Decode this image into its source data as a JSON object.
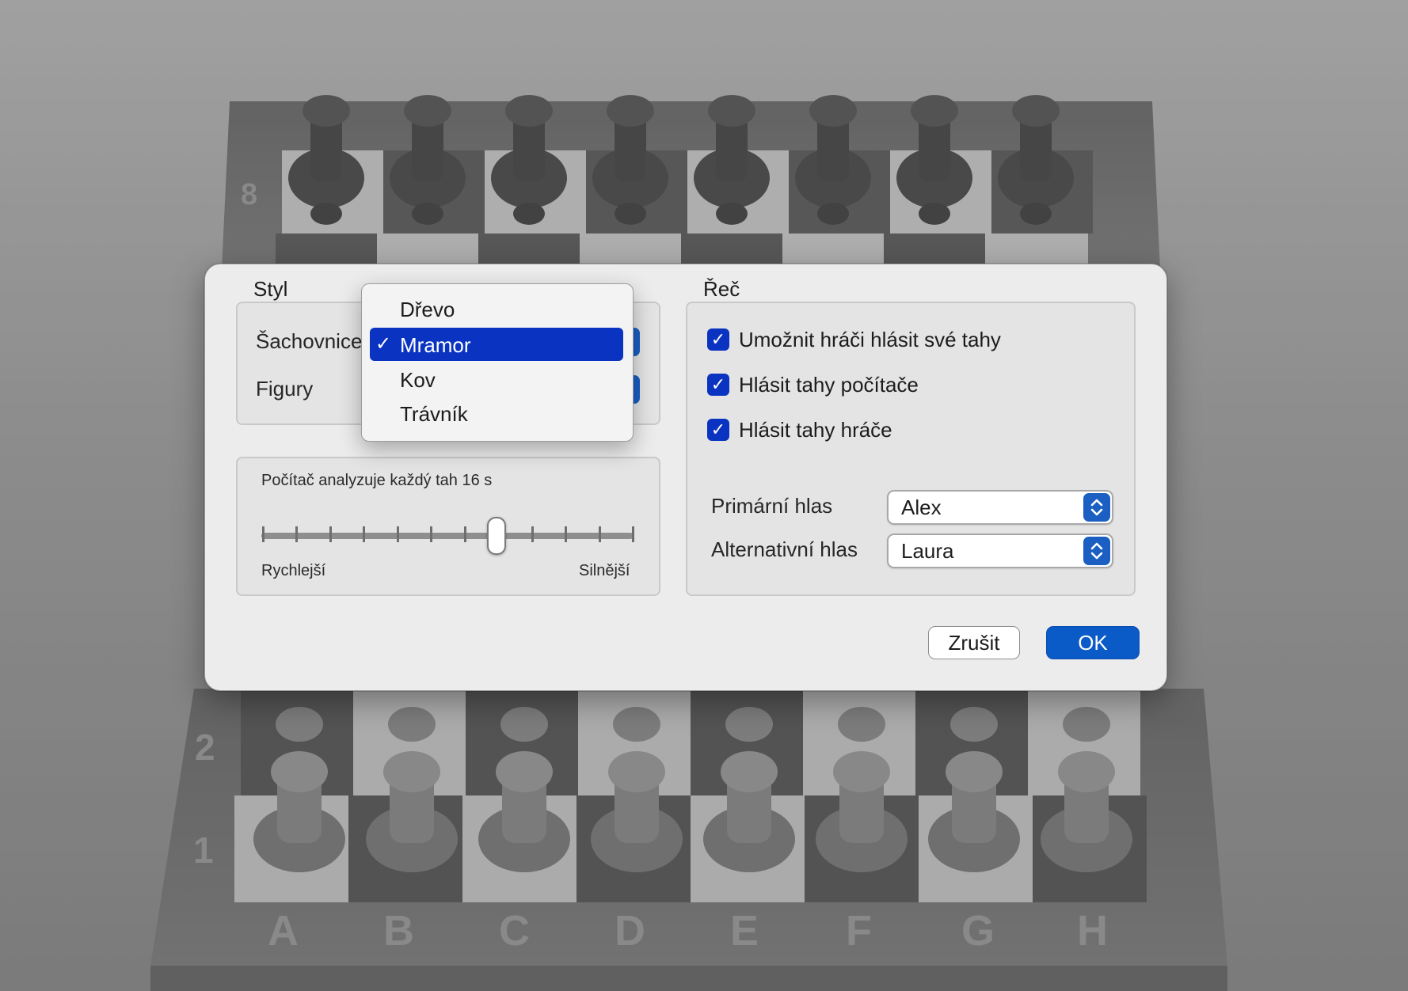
{
  "board": {
    "ranks_top": [
      "8"
    ],
    "ranks_bottom": [
      "2",
      "1"
    ],
    "files": [
      "A",
      "B",
      "C",
      "D",
      "E",
      "F",
      "G",
      "H"
    ]
  },
  "style_group": {
    "title": "Styl",
    "board_label": "Šachovnice",
    "pieces_label": "Figury",
    "menu": {
      "items": [
        "Dřevo",
        "Mramor",
        "Kov",
        "Trávník"
      ],
      "selected": "Mramor",
      "check": "✓"
    }
  },
  "strength_group": {
    "caption": "Počítač analyzuje každý tah 16 s",
    "left_label": "Rychlejší",
    "right_label": "Silnější",
    "value_fraction": 0.63
  },
  "speech_group": {
    "title": "Řeč",
    "checkboxes": [
      {
        "label": "Umožnit hráči hlásit své tahy",
        "checked": true
      },
      {
        "label": "Hlásit tahy počítače",
        "checked": true
      },
      {
        "label": "Hlásit tahy hráče",
        "checked": true
      }
    ],
    "primary_voice_label": "Primární hlas",
    "primary_voice_value": "Alex",
    "alt_voice_label": "Alternativní hlas",
    "alt_voice_value": "Laura"
  },
  "buttons": {
    "cancel": "Zrušit",
    "ok": "OK"
  },
  "colors": {
    "accent": "#0a33c2",
    "ok_button": "#0a5ac8"
  }
}
